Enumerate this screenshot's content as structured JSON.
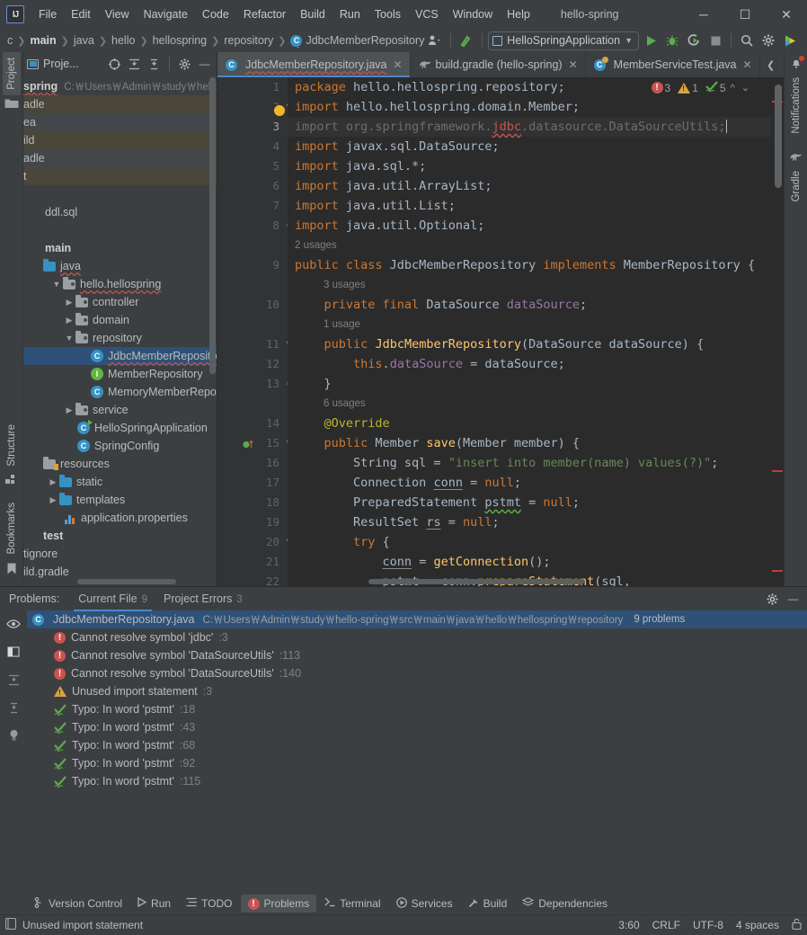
{
  "titlebar": {
    "logo": "IJ",
    "menus": [
      "File",
      "Edit",
      "View",
      "Navigate",
      "Code",
      "Refactor",
      "Build",
      "Run",
      "Tools",
      "VCS",
      "Window",
      "Help"
    ],
    "project_name": "hello-spring",
    "minimize": "─",
    "maximize": "☐",
    "close": "✕"
  },
  "navbar": {
    "breadcrumbs": [
      "c",
      "main",
      "java",
      "hello",
      "hellospring",
      "repository",
      "JdbcMemberRepository"
    ],
    "run_config": "HelloSpringApplication",
    "icons": [
      "profile-icon",
      "updates-icon",
      "run-icon",
      "debug-icon",
      "run-coverage-icon",
      "stop-icon",
      "search-icon",
      "settings-icon",
      "ai-assistant-icon"
    ]
  },
  "project_panel": {
    "title": "Proje...",
    "header_icons": [
      "select-opened-file-icon",
      "expand-all-icon",
      "collapse-all-icon",
      "settings-icon",
      "hide-icon"
    ],
    "tree": [
      {
        "label": "spring",
        "path": "C:￦Users￦Admin￦study￦hello-s",
        "kind": "project-root",
        "indent": 0,
        "bold": true,
        "wavy": true
      },
      {
        "label": "adle",
        "kind": "folder",
        "indent": 1,
        "state": "modified"
      },
      {
        "label": "ea",
        "kind": "folder",
        "indent": 1,
        "state": "alt"
      },
      {
        "label": "ild",
        "kind": "folder",
        "indent": 1,
        "state": "modified"
      },
      {
        "label": "adle",
        "kind": "folder",
        "indent": 1,
        "state": "alt"
      },
      {
        "label": "t",
        "kind": "folder",
        "indent": 1,
        "state": "modified"
      },
      {
        "label": "",
        "kind": "blank",
        "indent": 1
      },
      {
        "label": "ddl.sql",
        "kind": "file",
        "indent": 2
      },
      {
        "label": "",
        "kind": "blank",
        "indent": 1
      },
      {
        "label": "main",
        "kind": "folder-plain",
        "indent": 1,
        "bold": true
      },
      {
        "label": "java",
        "kind": "folder-blue",
        "indent": 2
      },
      {
        "label": "hello.hellospring",
        "kind": "package",
        "indent": 2,
        "arrow": "down",
        "wavy": true
      },
      {
        "label": "controller",
        "kind": "package",
        "indent": 3,
        "arrow": "right"
      },
      {
        "label": "domain",
        "kind": "package",
        "indent": 3,
        "arrow": "right"
      },
      {
        "label": "repository",
        "kind": "package",
        "indent": 3,
        "arrow": "down"
      },
      {
        "label": "JdbcMemberRepository",
        "kind": "class",
        "indent": 4,
        "selected": true,
        "wavy": true
      },
      {
        "label": "MemberRepository",
        "kind": "interface",
        "indent": 4
      },
      {
        "label": "MemoryMemberRepositor",
        "kind": "class",
        "indent": 4
      },
      {
        "label": "service",
        "kind": "package",
        "indent": 3,
        "arrow": "right"
      },
      {
        "label": "HelloSpringApplication",
        "kind": "spring-class",
        "indent": 3
      },
      {
        "label": "SpringConfig",
        "kind": "class",
        "indent": 3
      },
      {
        "label": "resources",
        "kind": "folder-res",
        "indent": 1
      },
      {
        "label": "static",
        "kind": "folder-blue",
        "indent": 2,
        "arrow": "right"
      },
      {
        "label": "templates",
        "kind": "folder-blue",
        "indent": 2,
        "arrow": "right"
      },
      {
        "label": "application.properties",
        "kind": "properties",
        "indent": 3
      },
      {
        "label": "test",
        "kind": "folder-plain",
        "indent": 1,
        "bold": true
      },
      {
        "label": "tignore",
        "kind": "file-plain",
        "indent": 0
      },
      {
        "label": "ild.gradle",
        "kind": "file-plain",
        "indent": 0
      }
    ]
  },
  "left_strip": {
    "tabs": [
      {
        "label": "Project",
        "icon": "project-folder-icon",
        "active": true
      },
      {
        "label": "Structure",
        "icon": "structure-icon",
        "active": false
      },
      {
        "label": "Bookmarks",
        "icon": "bookmark-icon",
        "active": false
      }
    ]
  },
  "right_strip": {
    "tabs": [
      {
        "label": "Notifications",
        "icon": "bell-icon",
        "badge": true
      },
      {
        "label": "Gradle",
        "icon": "gradle-elephant-icon",
        "badge": false
      }
    ]
  },
  "editor_tabs": [
    {
      "label": "JdbcMemberRepository.java",
      "icon": "java-class-icon",
      "active": true,
      "wavy": true
    },
    {
      "label": "build.gradle (hello-spring)",
      "icon": "gradle-elephant-icon",
      "active": false,
      "wavy": false
    },
    {
      "label": "MemberServiceTest.java",
      "icon": "java-test-class-icon",
      "active": false,
      "wavy": false
    }
  ],
  "editor": {
    "inspection_counts": {
      "errors": "3",
      "warnings": "1",
      "typos": "5"
    },
    "lines": [
      {
        "no": "1",
        "type": "code",
        "html": "<span class=\"kw\">package</span> hello.hellospring.repository;"
      },
      {
        "no": "2",
        "type": "code",
        "fold": "open",
        "bulb": true,
        "html": "<span class=\"kw\">import</span> hello.hellospring.domain.Member;"
      },
      {
        "no": "3",
        "type": "code",
        "current": true,
        "html": "<span class=\"gray\">import org.springframework.</span><span class=\"err wvr\">jdbc</span><span class=\"gray\">.datasource.DataSourceUtils;</span><span class=\"caret\"></span>"
      },
      {
        "no": "4",
        "type": "code",
        "html": "<span class=\"kw\">import</span> javax.sql.DataSource;"
      },
      {
        "no": "5",
        "type": "code",
        "html": "<span class=\"kw\">import</span> java.sql.*;"
      },
      {
        "no": "6",
        "type": "code",
        "html": "<span class=\"kw\">import</span> java.util.ArrayList;"
      },
      {
        "no": "7",
        "type": "code",
        "html": "<span class=\"kw\">import</span> java.util.List;"
      },
      {
        "no": "8",
        "type": "code",
        "fold": "close",
        "html": "<span class=\"kw\">import</span> java.util.Optional;"
      },
      {
        "no": "",
        "type": "hint",
        "text": "2 usages"
      },
      {
        "no": "9",
        "type": "code",
        "html": "<span class=\"kw\">public class</span> JdbcMemberRepository <span class=\"kw\">implements</span> MemberRepository {"
      },
      {
        "no": "",
        "type": "hint",
        "text": "3 usages",
        "pad": 4
      },
      {
        "no": "10",
        "type": "code",
        "html": "    <span class=\"kw\">private final</span> DataSource <span class=\"fld\">dataSource</span>;"
      },
      {
        "no": "",
        "type": "hint",
        "text": "1 usage",
        "pad": 4
      },
      {
        "no": "11",
        "type": "code",
        "fold": "open",
        "html": "    <span class=\"kw\">public</span> <span class=\"mth\">JdbcMemberRepository</span>(DataSource dataSource) {"
      },
      {
        "no": "12",
        "type": "code",
        "html": "        <span class=\"kw\">this</span>.<span class=\"fld\">dataSource</span> = dataSource;"
      },
      {
        "no": "13",
        "type": "code",
        "fold": "close",
        "html": "    }"
      },
      {
        "no": "",
        "type": "hint",
        "text": "6 usages",
        "pad": 4
      },
      {
        "no": "14",
        "type": "code",
        "html": "    <span class=\"ann\">@Override</span>"
      },
      {
        "no": "15",
        "type": "code",
        "fold": "open",
        "impl": true,
        "html": "    <span class=\"kw\">public</span> Member <span class=\"mth\">save</span>(Member member) {"
      },
      {
        "no": "16",
        "type": "code",
        "html": "        String sql = <span class=\"str\">\"insert into member(name) values(?)\"</span>;"
      },
      {
        "no": "17",
        "type": "code",
        "html": "        Connection <span class=\"undl\">conn</span> = <span class=\"kw\">null</span>;"
      },
      {
        "no": "18",
        "type": "code",
        "html": "        PreparedStatement <span class=\"wvg\">pstmt</span> = <span class=\"kw\">null</span>;"
      },
      {
        "no": "19",
        "type": "code",
        "html": "        ResultSet <span class=\"undl\">rs</span> = <span class=\"kw\">null</span>;"
      },
      {
        "no": "20",
        "type": "code",
        "fold": "open",
        "html": "        <span class=\"kw\">try</span> {"
      },
      {
        "no": "21",
        "type": "code",
        "html": "            <span class=\"undl\">conn</span> = <span class=\"mth\">getConnection</span>();"
      },
      {
        "no": "22",
        "type": "code",
        "html": "            <span class=\"wvg\">pstmt</span> = <span class=\"undl\">conn</span>.<span class=\"mth\">prepareStatement</span>(sql,"
      }
    ]
  },
  "problems": {
    "title": "Problems:",
    "tabs": [
      {
        "label": "Current File",
        "count": "9",
        "active": true
      },
      {
        "label": "Project Errors",
        "count": "3",
        "active": false
      }
    ],
    "header_icons": [
      "settings-icon",
      "hide-icon"
    ],
    "side_icons": [
      "preview-icon",
      "open-editor-preview-icon",
      "expand-all-icon",
      "collapse-all-icon",
      "inspection-bulb-icon"
    ],
    "file_row": {
      "name": "JdbcMemberRepository.java",
      "path": "C:￦Users￦Admin￦study￦hello-spring￦src￦main￦java￦hello￦hellospring￦repository",
      "count": "9 problems"
    },
    "items": [
      {
        "severity": "error",
        "text": "Cannot resolve symbol 'jdbc'",
        "line": ":3"
      },
      {
        "severity": "error",
        "text": "Cannot resolve symbol 'DataSourceUtils'",
        "line": ":113"
      },
      {
        "severity": "error",
        "text": "Cannot resolve symbol 'DataSourceUtils'",
        "line": ":140"
      },
      {
        "severity": "warning",
        "text": "Unused import statement",
        "line": ":3"
      },
      {
        "severity": "typo",
        "text": "Typo: In word 'pstmt'",
        "line": ":18"
      },
      {
        "severity": "typo",
        "text": "Typo: In word 'pstmt'",
        "line": ":43"
      },
      {
        "severity": "typo",
        "text": "Typo: In word 'pstmt'",
        "line": ":68"
      },
      {
        "severity": "typo",
        "text": "Typo: In word 'pstmt'",
        "line": ":92"
      },
      {
        "severity": "typo",
        "text": "Typo: In word 'pstmt'",
        "line": ":115"
      }
    ]
  },
  "tool_windows": [
    {
      "label": "Version Control",
      "icon": "branch-icon",
      "active": false
    },
    {
      "label": "Run",
      "icon": "run-icon",
      "active": false
    },
    {
      "label": "TODO",
      "icon": "todo-icon",
      "active": false
    },
    {
      "label": "Problems",
      "icon": "problems-error-icon",
      "active": true
    },
    {
      "label": "Terminal",
      "icon": "terminal-icon",
      "active": false
    },
    {
      "label": "Services",
      "icon": "services-icon",
      "active": false
    },
    {
      "label": "Build",
      "icon": "build-hammer-icon",
      "active": false
    },
    {
      "label": "Dependencies",
      "icon": "dependencies-icon",
      "active": false
    }
  ],
  "status_bar": {
    "message": "Unused import statement",
    "caret": "3:60",
    "line_separator": "CRLF",
    "encoding": "UTF-8",
    "indent": "4 spaces",
    "lock_icon": "read-write-lock-icon"
  },
  "colors": {
    "accent_blue": "#4a88c7",
    "error_red": "#c75450",
    "warning_yellow": "#d9a343",
    "typo_green": "#62b543",
    "selection_blue": "#2f5177",
    "panel_bg": "#3c3f41",
    "editor_bg": "#2b2b2b",
    "gutter_bg": "#313335"
  }
}
